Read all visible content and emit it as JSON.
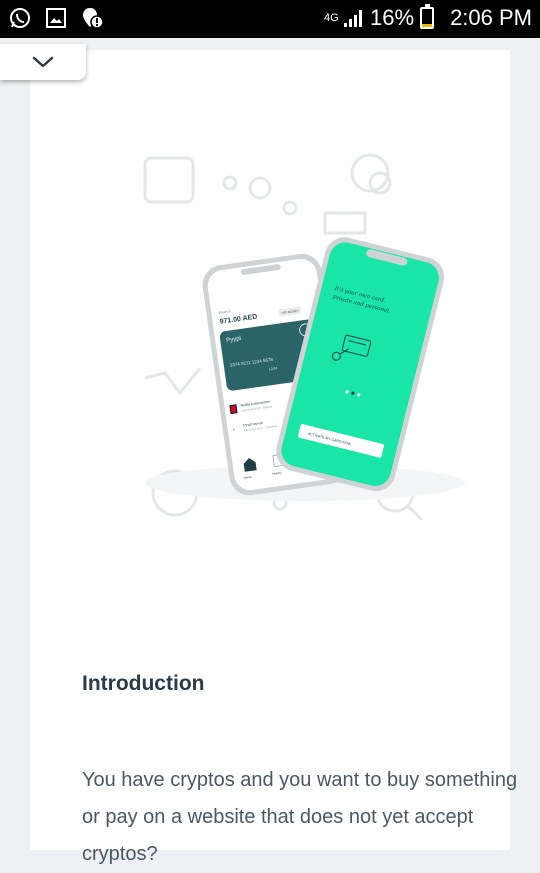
{
  "status_bar": {
    "network_type": "4G",
    "battery_percent": "16%",
    "battery_level": 0.16,
    "time": "2:06 PM",
    "icons": [
      "whatsapp-icon",
      "gallery-icon",
      "location-alert-icon",
      "signal-icon",
      "battery-icon"
    ]
  },
  "hero": {
    "balance": "971.00 AED",
    "balance_label": "Balance",
    "topup_label": "TOP MONEY",
    "card_brand": "Pyypl",
    "card_number": "3374 9211 1234 5678",
    "card_expiry": "12/24",
    "tx1_name": "Netflix subscription",
    "tx1_date": "Sun 09 Oct 2022 · Cleared",
    "tx1_amount": "-33.64",
    "tx2_name": "Pyypl top-up",
    "tx2_date": "Sat 01 Oct 2022 · Confirmed",
    "tx2_amount": "+250.00",
    "tab_home": "Home",
    "tab_history": "History",
    "tab_more": "Send",
    "screen2_text1": "It's your own card.",
    "screen2_text2": "Private and personal.",
    "activate_button": "ACTIVATE MY CARD NOW",
    "accent_color": "#19e6a6",
    "card_color": "#2a6368"
  },
  "article": {
    "heading": "Introduction",
    "paragraph": "You have cryptos and you want to buy something or pay on a website that does not yet accept cryptos?"
  }
}
